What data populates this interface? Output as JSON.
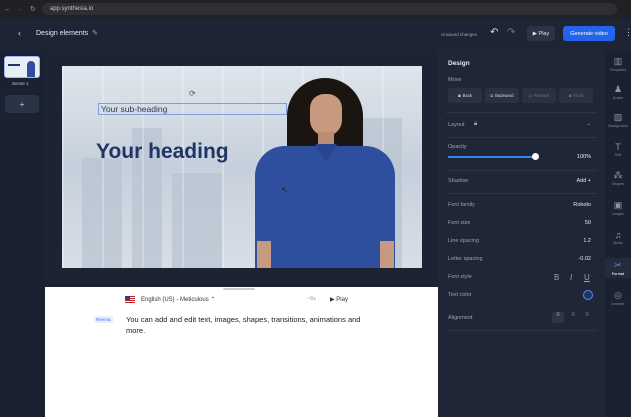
{
  "browser": {
    "url": "app.synthesia.io"
  },
  "header": {
    "title": "Design elements",
    "unsaved": "Unsaved changes",
    "play": "Play",
    "generate": "Generate video"
  },
  "scenes": {
    "label": "Scene 1",
    "add": "+"
  },
  "slide": {
    "subheading": "Your sub-heading",
    "heading": "Your heading"
  },
  "editor": {
    "voice": "English (US) - Meticulous ⌃",
    "duration": "~6s",
    "play": "Play",
    "speaker": "Reema",
    "script": "You can add and edit text, images, shapes, transitions, animations and more."
  },
  "panel": {
    "title": "Design",
    "move_label": "Move",
    "move_buttons": [
      "Back",
      "Backward",
      "Forward",
      "Front"
    ],
    "layout": "Layout",
    "opacity_label": "Opacity",
    "opacity_value": "100%",
    "opacity_fraction": 1.0,
    "shadow": "Shadow",
    "shadow_add": "Add +",
    "font_family": "Font family",
    "font_family_value": "Roboto",
    "font_size": "Font size",
    "font_size_value": "50",
    "line_spacing": "Line spacing",
    "line_spacing_value": "1.2",
    "letter_spacing": "Letter spacing",
    "letter_spacing_value": "-0.02",
    "font_style": "Font style",
    "bold": "B",
    "italic": "I",
    "underline": "U",
    "text_color": "Text color",
    "alignment": "Alignment"
  },
  "rail": [
    "Templates",
    "Avatar",
    "Background",
    "Text",
    "Shapes",
    "Images",
    "Media",
    "Format",
    "Animate"
  ],
  "colors": {
    "accent": "#2563eb",
    "heading": "#1f3566",
    "shirt": "#2e4f9e"
  }
}
